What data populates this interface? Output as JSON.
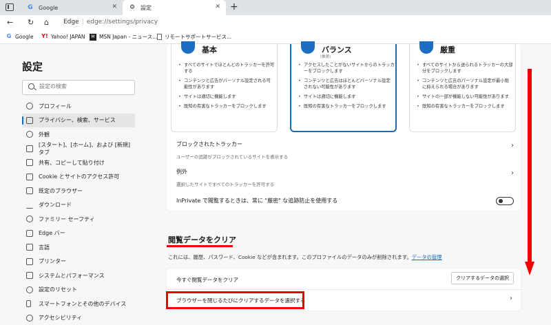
{
  "tabs": [
    {
      "title": "Google",
      "favicon": "google-icon"
    },
    {
      "title": "設定",
      "favicon": "gear-icon"
    }
  ],
  "address": {
    "brand": "Edge",
    "url": "edge://settings/privacy"
  },
  "favorites": [
    {
      "label": "Google",
      "icon": "google-icon"
    },
    {
      "label": "Yahoo! JAPAN",
      "icon": "yahoo-icon"
    },
    {
      "label": "MSN Japan - ニュース...",
      "icon": "msn-icon"
    },
    {
      "label": "リモートサポートサービス...",
      "icon": "page-icon"
    }
  ],
  "sidebar": {
    "title": "設定",
    "search_placeholder": "設定の検索",
    "items": [
      {
        "label": "プロフィール"
      },
      {
        "label": "プライバシー、検索、サービス",
        "selected": true
      },
      {
        "label": "外観"
      },
      {
        "label": "[スタート]、[ホーム]、および [新規] タブ"
      },
      {
        "label": "共有、コピーして貼り付け"
      },
      {
        "label": "Cookie とサイトのアクセス許可"
      },
      {
        "label": "既定のブラウザー"
      },
      {
        "label": "ダウンロード"
      },
      {
        "label": "ファミリー セーフティ"
      },
      {
        "label": "Edge バー"
      },
      {
        "label": "言語"
      },
      {
        "label": "プリンター"
      },
      {
        "label": "システムとパフォーマンス"
      },
      {
        "label": "設定のリセット"
      },
      {
        "label": "スマートフォンとその他のデバイス"
      },
      {
        "label": "アクセシビリティ"
      }
    ]
  },
  "tracking": {
    "levels": [
      {
        "title": "基本",
        "subtitle": "",
        "bullets": [
          "すべてのサイトでほとんどのトラッカーを許可する",
          "コンテンツと広告がパーソナル設定される可能性があります",
          "サイトは適切に機能します",
          "既知の有害なトラッカーをブロックします"
        ]
      },
      {
        "title": "バランス",
        "subtitle": "(推奨)",
        "bullets": [
          "アクセスしたことがないサイトからのトラッカーをブロックします",
          "コンテンツと広告はほとんどパーソナル設定されない可能性があります",
          "サイトは適切に機能します",
          "既知の有害なトラッカーをブロックします"
        ]
      },
      {
        "title": "厳重",
        "subtitle": "",
        "bullets": [
          "すべてのサイトから送られるトラッカーの大部分をブロックします",
          "コンテンツと広告のパーソナル設定が最小限に抑えられる場合があります",
          "サイトの一部が機能しない可能性があります",
          "既知の有害なトラッカーをブロックします"
        ]
      }
    ],
    "blocked": {
      "title": "ブロックされたトラッカー",
      "desc": "ユーザーの追跡がブロックされているサイトを表示する"
    },
    "exceptions": {
      "title": "例外",
      "desc": "選択したサイトですべてのトラッカーを許可する"
    },
    "inprivate": {
      "label": "InPrivate で閲覧するときは、常に \"厳密\" な追跡防止を使用する",
      "enabled": false
    }
  },
  "clear_data": {
    "heading": "閲覧データをクリア",
    "desc": "これには、履歴、パスワード、Cookie などが含まれます。このプロファイルのデータのみが削除されます。",
    "link": "データの管理",
    "clear_now": "今すぐ閲覧データをクリア",
    "choose_button": "クリアするデータの選択",
    "on_close": "ブラウザーを閉じるたびにクリアするデータを選択する"
  },
  "colors": {
    "accent": "#0f6cbd",
    "highlight": "#e00000"
  }
}
